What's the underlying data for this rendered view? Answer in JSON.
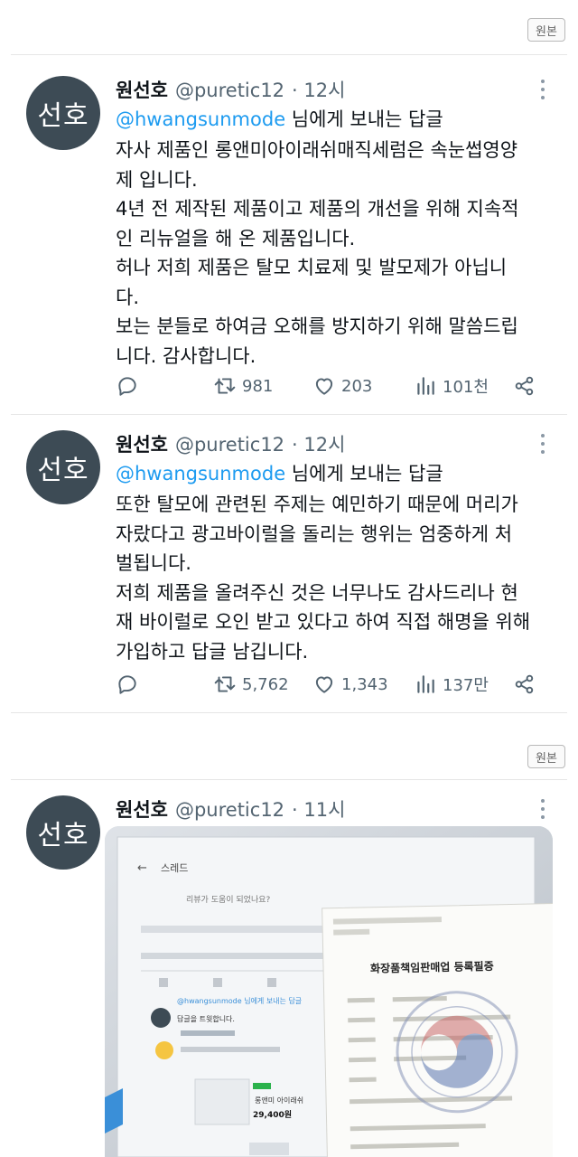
{
  "original_label": "원본",
  "tweets": [
    {
      "avatar": "선호",
      "name": "원선호",
      "handle": "@puretic12",
      "time": "· 12시",
      "reply_mention": "@hwangsunmode",
      "reply_suffix": " 님에게 보내는 답글",
      "lines": [
        "자사 제품인 롱앤미아이래쉬매직세럼은 속눈썹영양",
        "제 입니다.",
        "4년 전 제작된 제품이고 제품의 개선을 위해 지속적",
        "인 리뉴얼을 해 온 제품입니다.",
        "허나 저희 제품은 탈모 치료제 및 발모제가 아닙니",
        "다.",
        "보는 분들로 하여금 오해를 방지하기 위해 말씀드립",
        "니다. 감사합니다."
      ],
      "retweets": "981",
      "likes": "203",
      "views": "101천"
    },
    {
      "avatar": "선호",
      "name": "원선호",
      "handle": "@puretic12",
      "time": "· 12시",
      "reply_mention": "@hwangsunmode",
      "reply_suffix": " 님에게 보내는 답글",
      "lines": [
        "또한 탈모에 관련된 주제는 예민하기 때문에 머리가",
        "자랐다고 광고바이럴을 돌리는 행위는 엄중하게 처",
        "벌됩니다.",
        "저희 제품을 올려주신 것은 너무나도 감사드리나 현",
        "재 바이럴로 오인 받고 있다고 하여 직접 해명을 위해",
        "가입하고 답글 남깁니다."
      ],
      "retweets": "5,762",
      "likes": "1,343",
      "views": "137만"
    },
    {
      "avatar": "선호",
      "name": "원선호",
      "handle": "@puretic12",
      "time": "· 11시"
    }
  ],
  "photo": {
    "screen_title": "스레드",
    "screen_question": "리뷰가 도움이 되었나요?",
    "screen_mention": "@hwangsunmode 님에게 보내는 답글",
    "screen_reply": "답글을 트윗합니다.",
    "screen_price": "29,400원",
    "screen_product": "롱앤미 아이래쉬",
    "doc_title": "화장품책임판매업 등록필증",
    "icons": [
      "back-arrow-icon",
      "official-seal-icon"
    ]
  },
  "colors": {
    "mention": "#1d9bf0",
    "avatar_bg": "#3d4b55",
    "muted": "#536471"
  }
}
